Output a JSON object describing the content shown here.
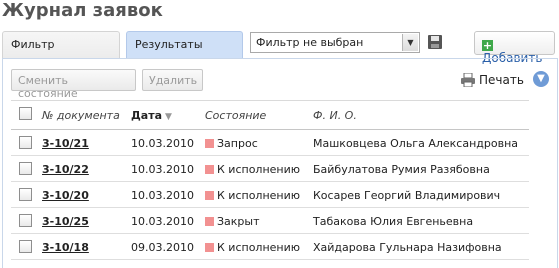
{
  "page": {
    "title": "Журнал заявок"
  },
  "tabs": [
    {
      "label": "Фильтр",
      "active": false
    },
    {
      "label": "Результаты",
      "active": true
    }
  ],
  "filter": {
    "selected": "Фильтр не выбран"
  },
  "toolbar": {
    "add_label": "Добавить",
    "change_state_label": "Сменить состояние",
    "delete_label": "Удалить",
    "print_label": "Печать"
  },
  "table": {
    "columns": [
      "№ документа",
      "Дата",
      "Состояние",
      "Ф. И. О."
    ],
    "sorted_column": "Дата",
    "rows": [
      {
        "doc": "3-10/21",
        "date": "10.03.2010",
        "state": "Запрос",
        "fio": "Машковцева Ольга Александровна"
      },
      {
        "doc": "3-10/22",
        "date": "10.03.2010",
        "state": "К исполнению",
        "fio": "Байбулатова Румия Разябовна"
      },
      {
        "doc": "3-10/20",
        "date": "10.03.2010",
        "state": "К исполнению",
        "fio": "Косарев Георгий Владимирович"
      },
      {
        "doc": "3-10/25",
        "date": "10.03.2010",
        "state": "Закрыт",
        "fio": "Табакова Юлия Евгеньевна"
      },
      {
        "doc": "3-10/18",
        "date": "09.03.2010",
        "state": "К исполнению",
        "fio": "Хайдарова Гульнара Назифовна"
      }
    ]
  },
  "colors": {
    "status": "#f29191",
    "active_tab": "#cfe0f7",
    "link": "#2a5fa8"
  },
  "icons": {
    "save": "floppy-disk-icon",
    "add": "plus-icon",
    "print": "printer-icon",
    "info": "info-icon"
  }
}
